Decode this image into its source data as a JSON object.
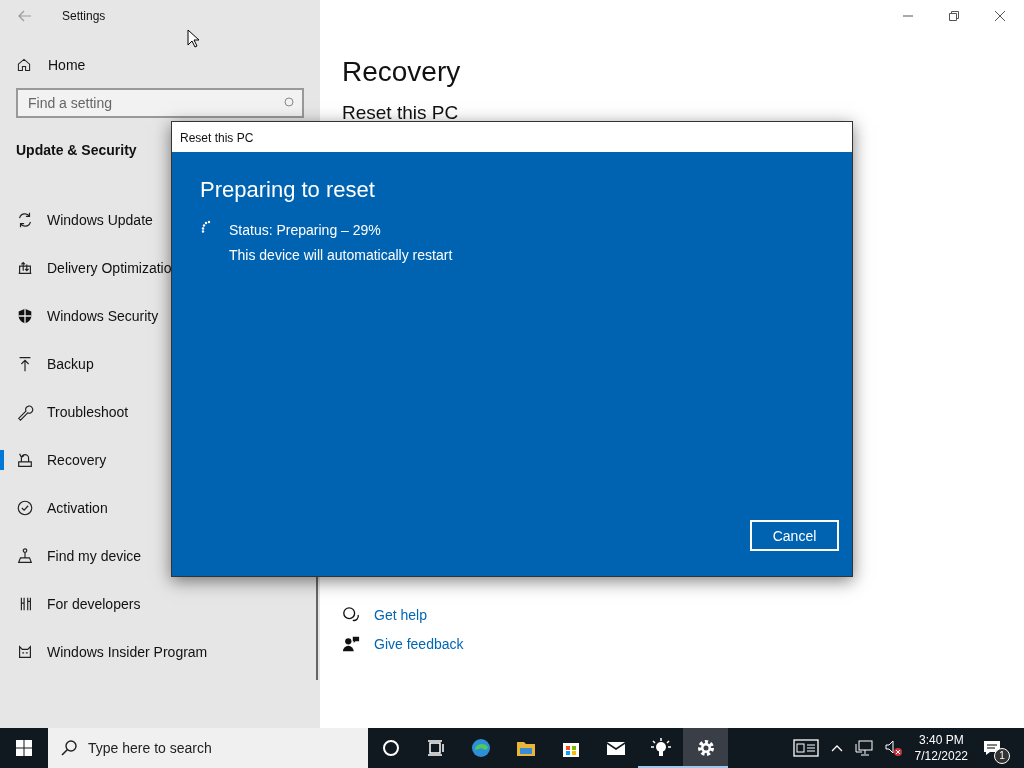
{
  "window": {
    "title": "Settings"
  },
  "sidebar": {
    "home": "Home",
    "search": {
      "placeholder": "Find a setting"
    },
    "section": "Update & Security",
    "items": [
      {
        "label": "Windows Update",
        "selected": false
      },
      {
        "label": "Delivery Optimizatio",
        "selected": false
      },
      {
        "label": "Windows Security",
        "selected": false
      },
      {
        "label": "Backup",
        "selected": false
      },
      {
        "label": "Troubleshoot",
        "selected": false
      },
      {
        "label": "Recovery",
        "selected": true
      },
      {
        "label": "Activation",
        "selected": false
      },
      {
        "label": "Find my device",
        "selected": false
      },
      {
        "label": "For developers",
        "selected": false
      },
      {
        "label": "Windows Insider Program",
        "selected": false
      }
    ]
  },
  "main": {
    "title": "Recovery",
    "subtitle": "Reset this PC",
    "links": [
      "Get help",
      "Give feedback"
    ]
  },
  "dialog": {
    "title": "Reset this PC",
    "heading": "Preparing to reset",
    "status": "Status: Preparing – 29%",
    "note": "This device will automatically restart",
    "button": "Cancel"
  },
  "taskbar": {
    "search": {
      "placeholder": "Type here to search"
    },
    "apps": [
      {
        "running": false,
        "selected": false
      },
      {
        "running": false,
        "selected": false
      },
      {
        "running": false,
        "selected": false
      },
      {
        "running": false,
        "selected": false
      },
      {
        "running": false,
        "selected": false
      },
      {
        "running": false,
        "selected": false
      },
      {
        "running": true,
        "selected": false
      },
      {
        "running": true,
        "selected": true
      }
    ],
    "time": "3:40 PM",
    "date": "7/12/2022",
    "notifications": "1"
  }
}
